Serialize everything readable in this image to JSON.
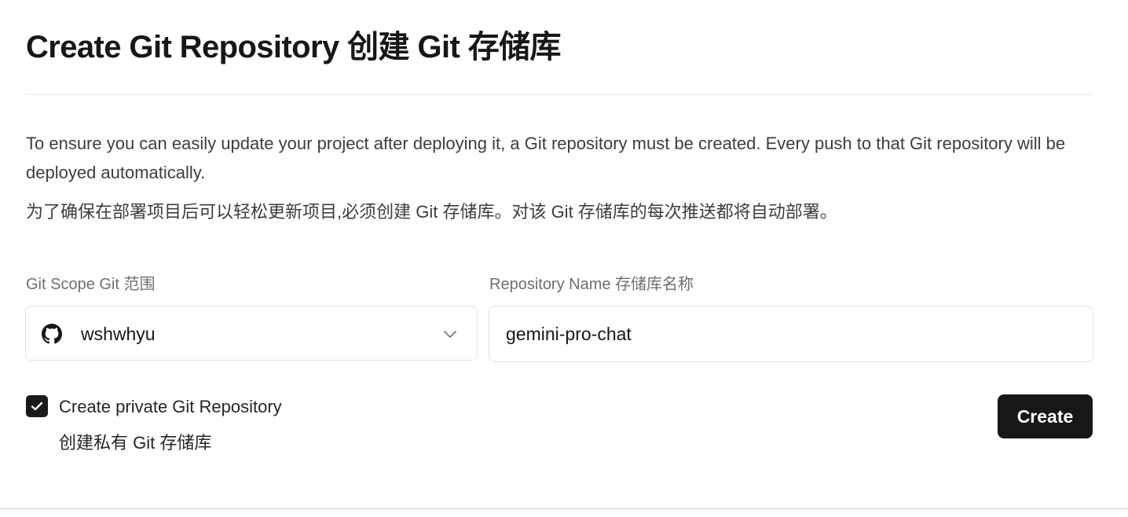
{
  "page": {
    "title": "Create Git Repository 创建 Git 存储库"
  },
  "description": {
    "english": "To ensure you can easily update your project after deploying it, a Git repository must be created. Every push to that Git repository will be deployed automatically.",
    "chinese": "为了确保在部署项目后可以轻松更新项目,必须创建 Git 存储库。对该 Git 存储库的每次推送都将自动部署。"
  },
  "form": {
    "scope": {
      "label": "Git Scope Git 范围",
      "value": "wshwhyu",
      "icon": "github-icon"
    },
    "repo_name": {
      "label": "Repository Name 存储库名称",
      "value": "gemini-pro-chat"
    },
    "private_repo": {
      "checked": true,
      "label": "Create private Git Repository",
      "sublabel": "创建私有 Git 存储库"
    },
    "submit_label": "Create"
  },
  "colors": {
    "primary_button": "#171717",
    "border": "#e3e3e3",
    "muted_text": "#6f6f6f"
  }
}
